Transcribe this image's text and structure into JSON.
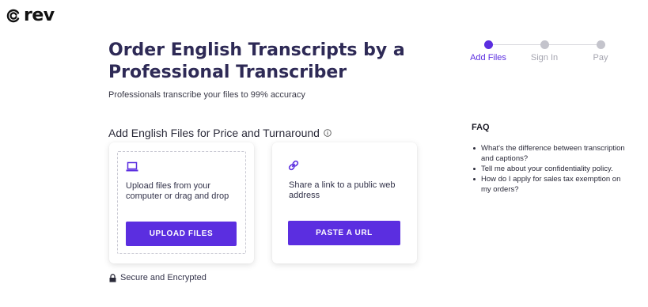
{
  "brand": {
    "name": "rev",
    "accent": "#5b2ee0",
    "logo_icon": "rev-logo-icon"
  },
  "page": {
    "title_line1": "Order English Transcripts by a",
    "title_line2": "Professional Transcriber",
    "subtitle": "Professionals transcribe your files to 99% accuracy",
    "section_title": "Add English Files for Price and Turnaround",
    "section_icon": "info-icon"
  },
  "upload_card": {
    "icon": "laptop-icon",
    "text_line1": "Upload files from your",
    "text_line2": "computer or drag and drop",
    "button_label": "UPLOAD FILES"
  },
  "url_card": {
    "icon": "link-icon",
    "text_line1": "Share a link to a public web",
    "text_line2": "address",
    "button_label": "PASTE A URL"
  },
  "secure": {
    "icon": "lock-icon",
    "label": "Secure and Encrypted"
  },
  "stepper": {
    "steps": [
      {
        "label": "Add Files",
        "active": true
      },
      {
        "label": "Sign In",
        "active": false
      },
      {
        "label": "Pay",
        "active": false
      }
    ]
  },
  "faq": {
    "title": "FAQ",
    "items": [
      "What's the difference between transcription and captions?",
      "Tell me about your confidentiality policy.",
      "How do I apply for sales tax exemption on my orders?"
    ]
  }
}
